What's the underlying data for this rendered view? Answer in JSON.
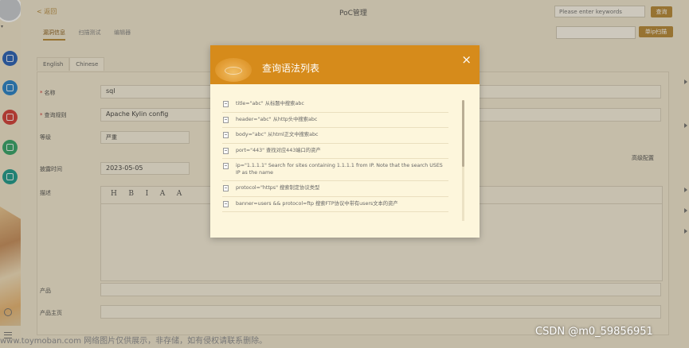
{
  "app": {
    "back_label": "< 返回",
    "title": "PoC管理",
    "search": {
      "placeholder": "Please enter keywords",
      "button": "查询"
    },
    "scan_button": "单ip扫描",
    "top_tabs": [
      "漏洞信息",
      "扫描测试",
      "编辑器"
    ]
  },
  "form": {
    "lang_tabs": [
      "English",
      "Chinese"
    ],
    "name_label": "名称",
    "name_value": "sql",
    "rule_label": "查询规则",
    "rule_value": "Apache Kylin config",
    "level_label": "等级",
    "level_value": "严重",
    "date_label": "披露时间",
    "date_value": "2023-05-05",
    "desc_label": "描述",
    "advanced_label": "高级配置",
    "toolbar": [
      "H",
      "B",
      "I",
      "A",
      "A"
    ],
    "product_label": "产品",
    "homepage_label": "产品主页"
  },
  "modal": {
    "title": "查询语法列表",
    "close": "×",
    "items": [
      "title=\"abc\" 从标题中搜索abc",
      "header=\"abc\" 从http头中搜索abc",
      "body=\"abc\" 从html正文中搜索abc",
      "port=\"443\" 查找对应443端口的资产",
      "ip=\"1.1.1.1\" Search for sites containing 1.1.1.1 from IP. Note that the search USES IP as the name",
      "protocol=\"https\" 搜索制定协议类型",
      "banner=users && protocol=ftp 搜索FTP协议中带有users文本的资产"
    ]
  },
  "watermark": "www.toymoban.com 网络图片仅供展示，非存储，如有侵权请联系删除。",
  "csdn": "CSDN @m0_59856951",
  "colors": {
    "accent": "#d68b1b",
    "button": "#b78a3a",
    "modal_bg": "#fdf6dc"
  },
  "dock_icons": [
    {
      "name": "drive-icon",
      "color": "#2a62b8"
    },
    {
      "name": "table-icon",
      "color": "#2a83c9"
    },
    {
      "name": "briefcase-icon",
      "color": "#d2403a"
    },
    {
      "name": "chat-icon",
      "color": "#36a56b"
    },
    {
      "name": "puzzle-icon",
      "color": "#1f9b8e"
    }
  ]
}
